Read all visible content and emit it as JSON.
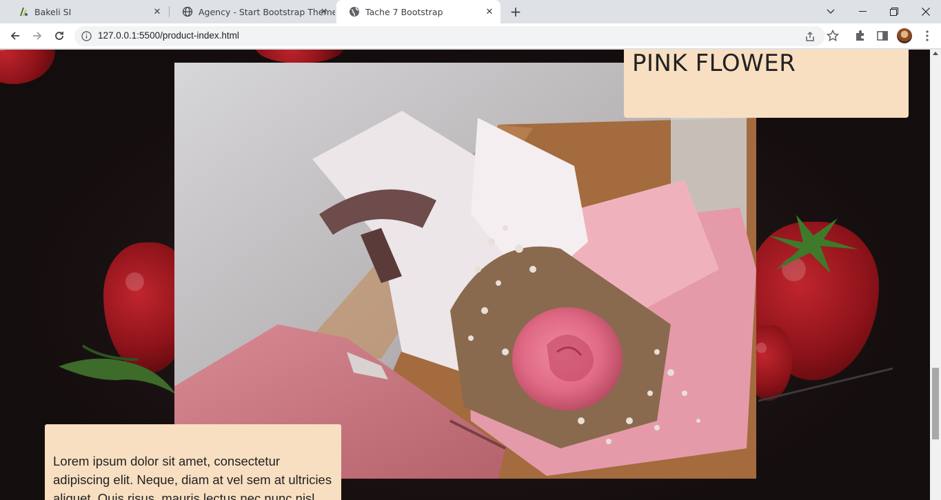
{
  "browser": {
    "tabs": [
      {
        "title": "Bakeli SI",
        "favicon": "bakeli-logo-icon"
      },
      {
        "title": "Agency - Start Bootstrap Theme",
        "favicon": "globe-icon"
      },
      {
        "title": "Tache 7 Bootstrap",
        "favicon": "globe-icon",
        "active": true
      }
    ],
    "url": "127.0.0.1:5500/product-index.html"
  },
  "page": {
    "product_title": "PINK FLOWER",
    "description": "Lorem ipsum dolor sit amet, consectetur adipiscing elit. Neque, diam at vel sem at ultricies aliquet. Quis risus, mauris lectus nec nunc nisl"
  },
  "colors": {
    "card_background": "#f8dfc2",
    "page_background": "#140d0d"
  }
}
